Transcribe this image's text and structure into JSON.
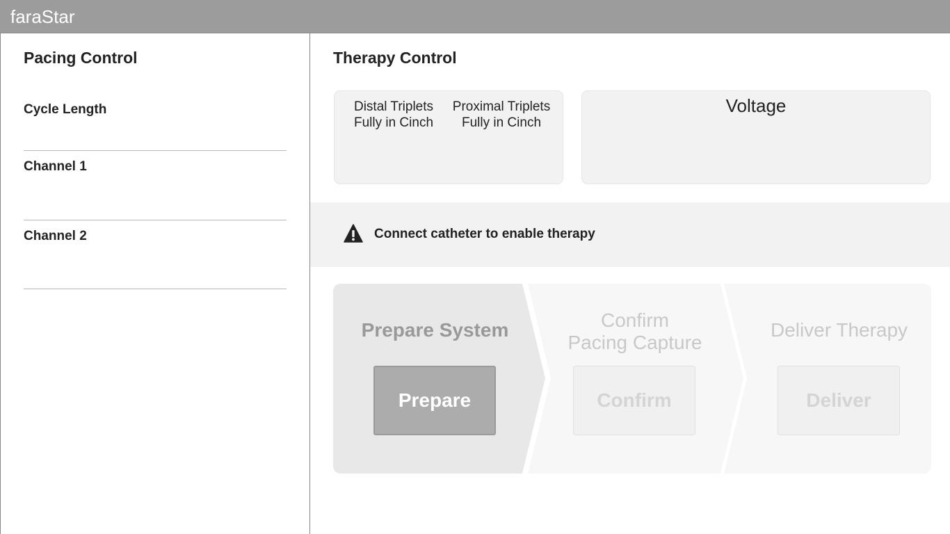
{
  "app": {
    "title": "faraStar"
  },
  "pacing": {
    "title": "Pacing Control",
    "fields": [
      {
        "label": "Cycle Length"
      },
      {
        "label": "Channel 1"
      },
      {
        "label": "Channel 2"
      }
    ]
  },
  "therapy": {
    "title": "Therapy Control",
    "triplets": [
      {
        "line1": "Distal Triplets",
        "line2": "Fully in Cinch"
      },
      {
        "line1": "Proximal Triplets",
        "line2": "Fully in Cinch"
      }
    ],
    "voltage_label": "Voltage",
    "alert": {
      "icon": "warning-icon",
      "text": "Connect catheter to enable therapy"
    },
    "steps": [
      {
        "title_line1": "Prepare System",
        "title_line2": "",
        "button": "Prepare",
        "state": "active"
      },
      {
        "title_line1": "Confirm",
        "title_line2": "Pacing Capture",
        "button": "Confirm",
        "state": "disabled"
      },
      {
        "title_line1": "Deliver Therapy",
        "title_line2": "",
        "button": "Deliver",
        "state": "disabled"
      }
    ]
  },
  "colors": {
    "titlebar": "#9c9c9c",
    "panel_bg": "#f2f2f2",
    "step_active_bg": "#e8e8e8",
    "step_inactive_bg": "#f7f7f7",
    "button_active": "#acacac",
    "text_active_step": "#999999",
    "text_inactive_step": "#c8c8c8"
  }
}
